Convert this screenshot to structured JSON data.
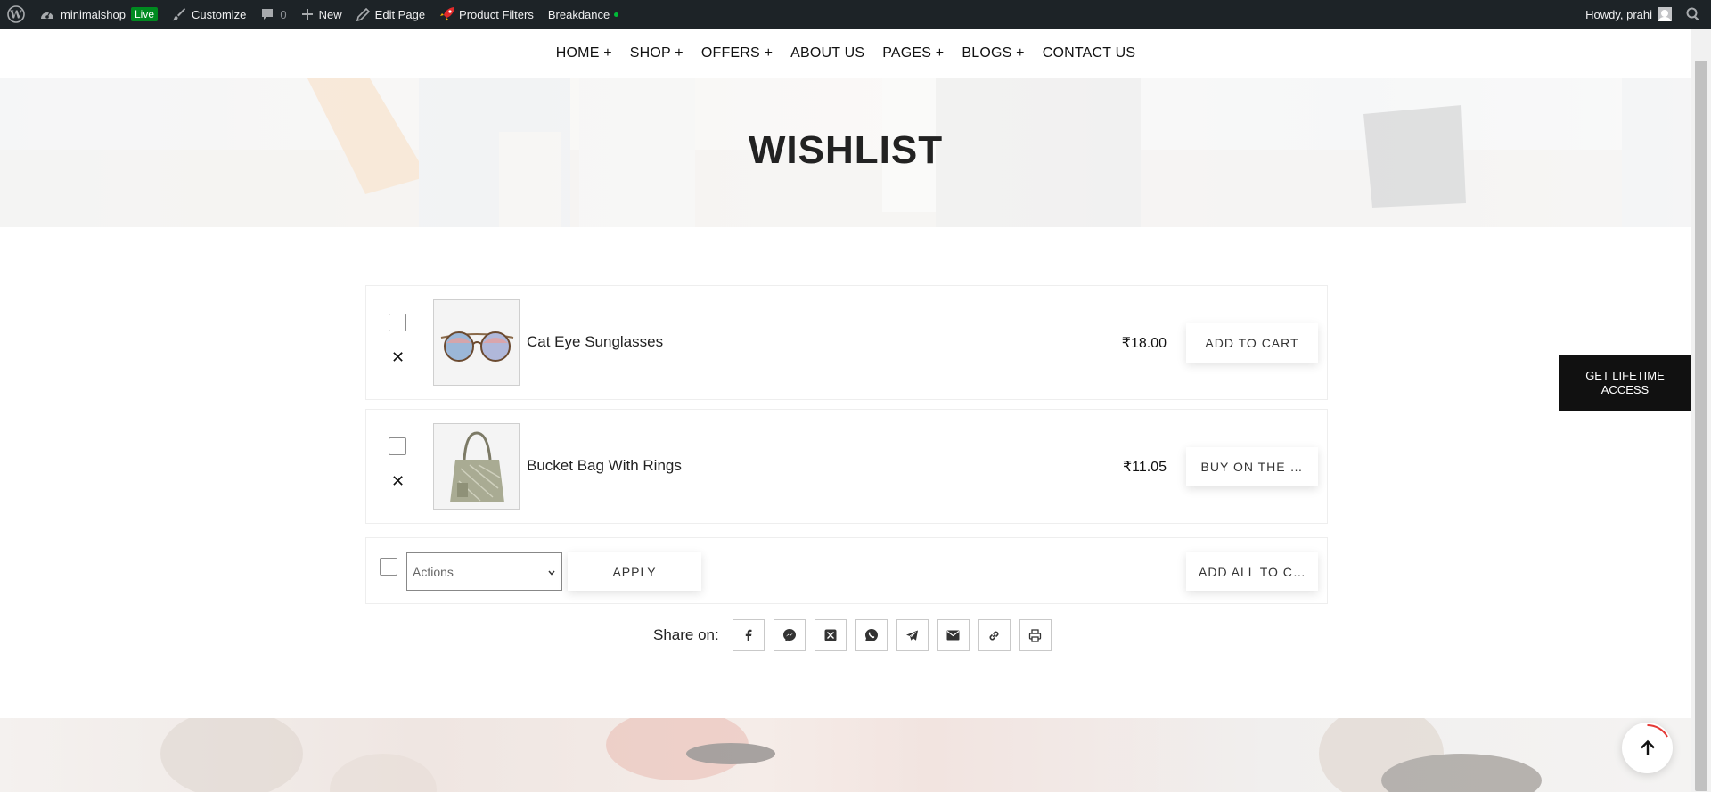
{
  "adminbar": {
    "site_name": "minimalshop",
    "live_badge": "Live",
    "customize": "Customize",
    "comments_count": "0",
    "new": "New",
    "edit_page": "Edit Page",
    "product_filters": "Product Filters",
    "breakdance": "Breakdance",
    "howdy": "Howdy, prahi"
  },
  "nav": {
    "items": [
      "HOME +",
      "SHOP +",
      "OFFERS +",
      "ABOUT US",
      "PAGES +",
      "BLOGS +",
      "CONTACT US"
    ]
  },
  "hero": {
    "title": "WISHLIST"
  },
  "wishlist": {
    "items": [
      {
        "name": "Cat Eye Sunglasses",
        "price": "₹18.00",
        "button": "ADD TO CART"
      },
      {
        "name": "Bucket Bag With Rings",
        "price": "₹11.05",
        "button": "BUY ON THE …"
      }
    ],
    "actions_select": "Actions",
    "apply": "APPLY",
    "add_all": "ADD ALL TO C…"
  },
  "share": {
    "label": "Share on:"
  },
  "lifetime_cta": "GET LIFETIME ACCESS",
  "colors": {
    "adminbar_bg": "#1d2327",
    "live_green": "#008a20",
    "cta_bg": "#111111"
  }
}
